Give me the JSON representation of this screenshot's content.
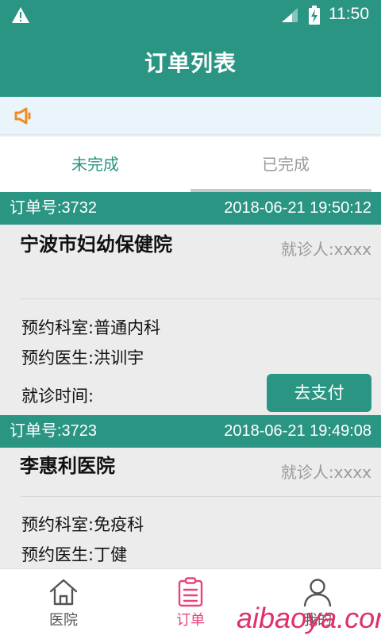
{
  "status_bar": {
    "time": "11:50"
  },
  "app_bar": {
    "title": "订单列表"
  },
  "tabs": [
    {
      "label": "未完成",
      "active": true
    },
    {
      "label": "已完成",
      "active": false
    }
  ],
  "orders": [
    {
      "order_no": "订单号:3732",
      "date": "2018-06-21 19:50:12",
      "hospital": "宁波市妇幼保健院",
      "patient": "就诊人:xxxx",
      "department": "预约科室:普通内科",
      "doctor": "预约医生:洪训宇",
      "visit_time": "就诊时间:",
      "pay_label": "去支付"
    },
    {
      "order_no": "订单号:3723",
      "date": "2018-06-21 19:49:08",
      "hospital": "李惠利医院",
      "patient": "就诊人:xxxx",
      "department": "预约科室:免疫科",
      "doctor": "预约医生:丁健"
    }
  ],
  "bottom_nav": [
    {
      "label": "医院",
      "icon": "home-icon",
      "active": false
    },
    {
      "label": "订单",
      "icon": "clipboard-icon",
      "active": true
    },
    {
      "label": "我的",
      "icon": "person-icon",
      "active": false
    }
  ],
  "watermark": "aibaoya.com",
  "colors": {
    "primary": "#2b9584",
    "active_nav": "#e6447a",
    "notice_bg": "#eaf4fb",
    "speaker": "#f08a24"
  }
}
